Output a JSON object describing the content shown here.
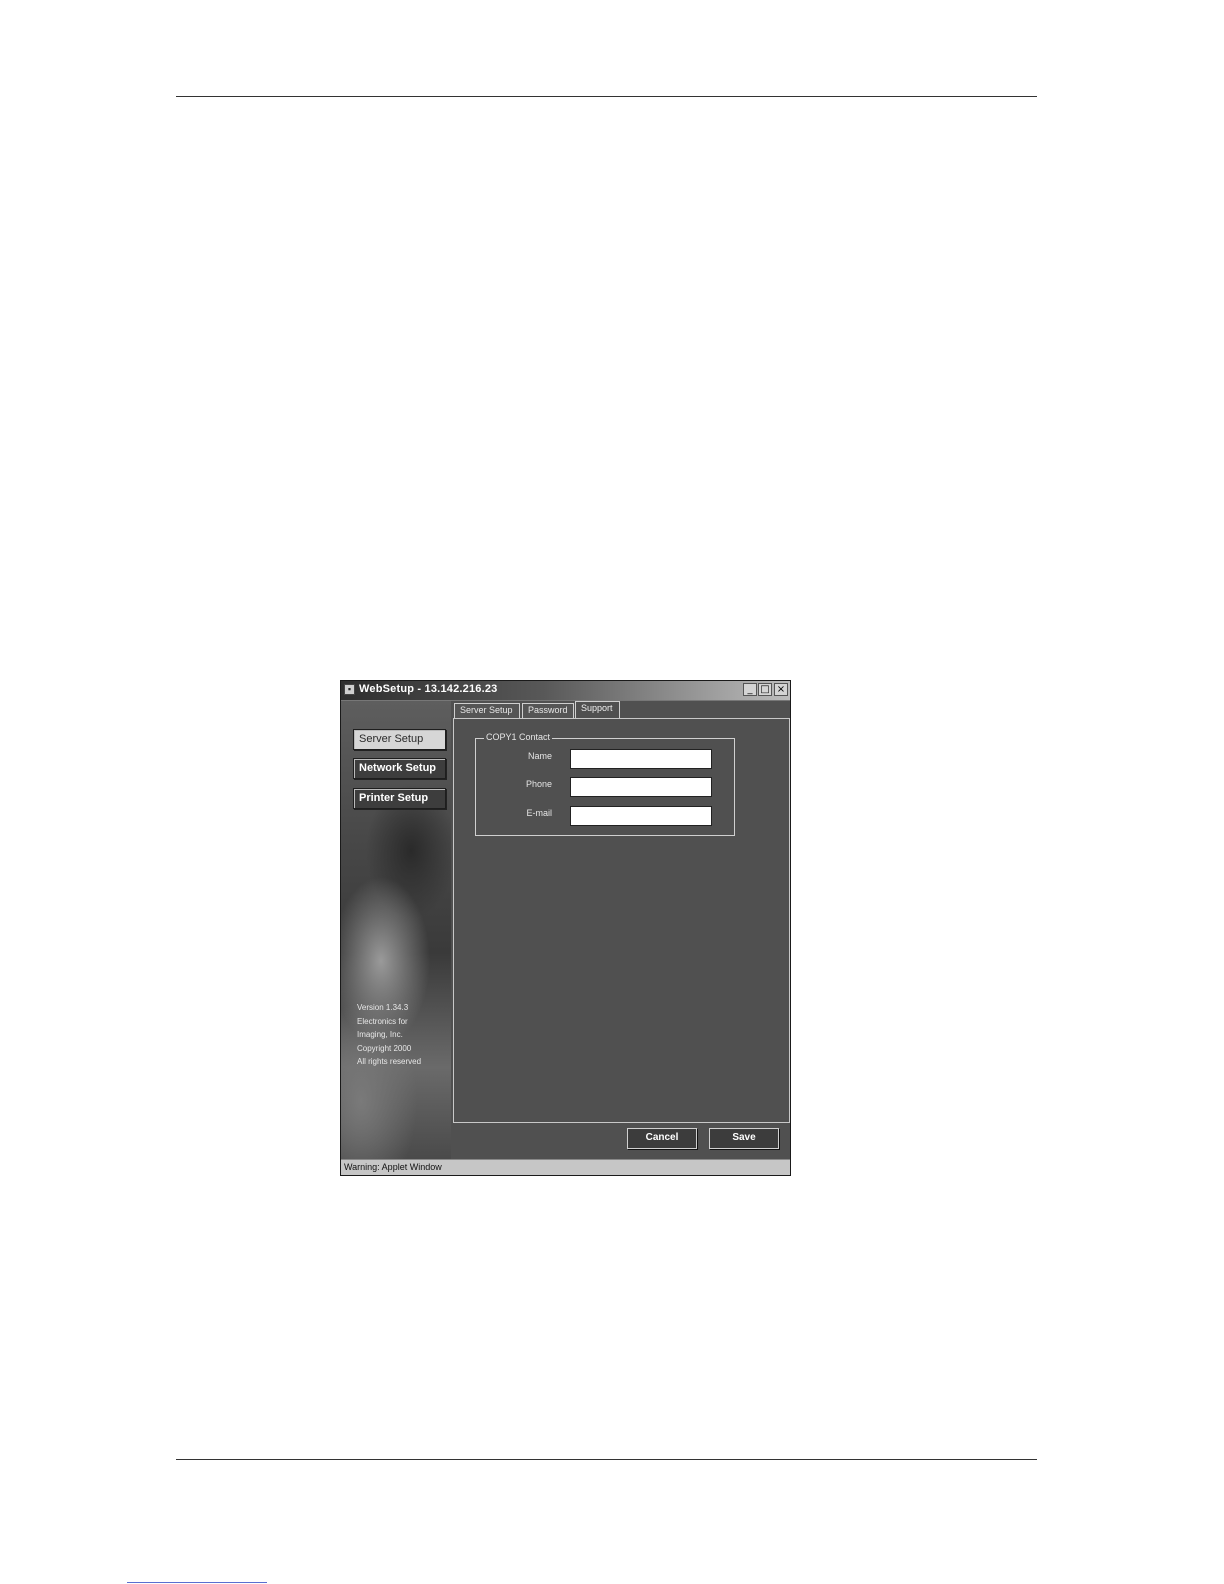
{
  "window": {
    "title": "WebSetup - 13.142.216.23",
    "controls": {
      "minimize": "_",
      "maximize": "□",
      "close": "×"
    }
  },
  "sidebar": {
    "buttons": [
      {
        "label": "Server Setup",
        "active": true
      },
      {
        "label": "Network Setup",
        "active": false
      },
      {
        "label": "Printer Setup",
        "active": false
      }
    ],
    "version_text": "Version 1.34.3\nElectronics for\nImaging, Inc.\nCopyright 2000\nAll rights reserved"
  },
  "tabs": [
    {
      "label": "Server Setup",
      "selected": false
    },
    {
      "label": "Password",
      "selected": false
    },
    {
      "label": "Support",
      "selected": true
    }
  ],
  "contact_group": {
    "legend": "COPY1 Contact",
    "fields": [
      {
        "label": "Name",
        "value": "",
        "placeholder": ""
      },
      {
        "label": "Phone",
        "value": "",
        "placeholder": ""
      },
      {
        "label": "E-mail",
        "value": "",
        "placeholder": ""
      }
    ]
  },
  "buttons": {
    "cancel": "Cancel",
    "save": "Save"
  },
  "status": {
    "text": "Warning: Applet Window"
  }
}
